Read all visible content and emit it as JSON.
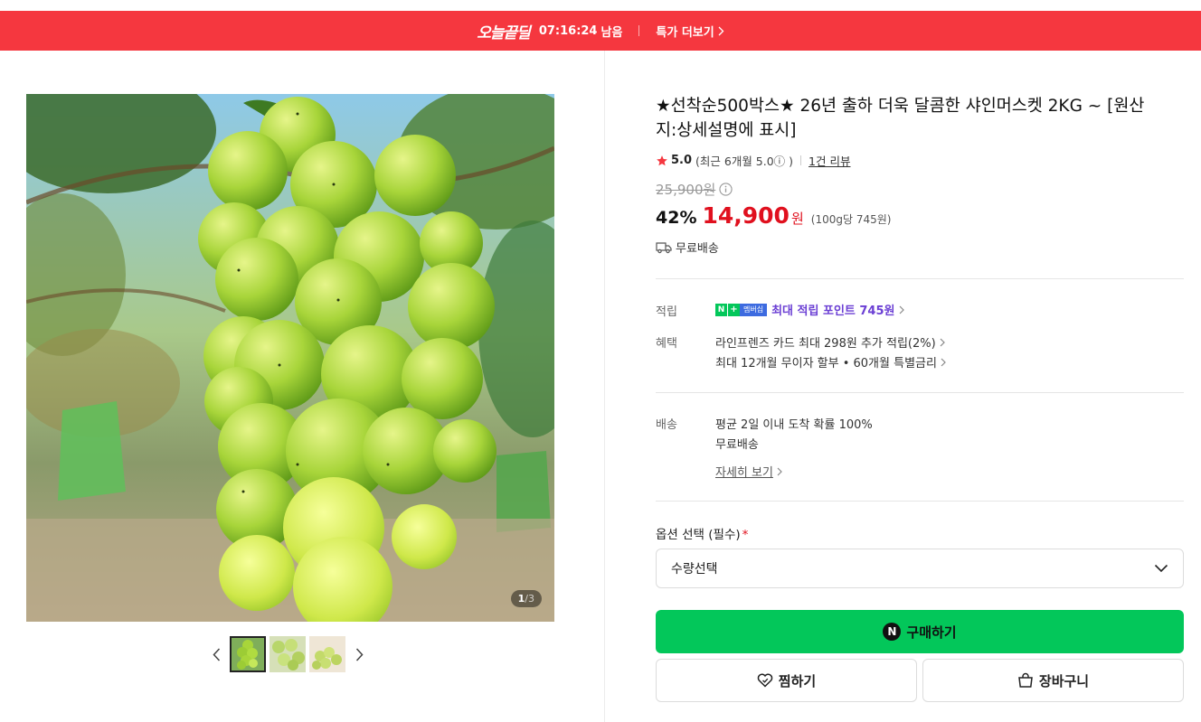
{
  "banner": {
    "logo": "오늘끝딜",
    "time": "07:16:24",
    "time_suffix": "남음",
    "link": "특가 더보기",
    "color": "#f5373f"
  },
  "gallery": {
    "counter_current": "1",
    "counter_total": "/3",
    "thumbs": [
      "thumb-1",
      "thumb-2",
      "thumb-3"
    ],
    "prev_icon": "chevron-left-icon",
    "next_icon": "chevron-right-icon"
  },
  "product": {
    "title": "★선착순500박스★ 26년 출하 더욱 달콤한 샤인머스켓 2KG ~ [원산지:상세설명에 표시]",
    "rating_score": "5.0",
    "rating_recent": "(최근 6개월 5.0ⓘ )",
    "review_link": "1건 리뷰",
    "original_price": "25,900원",
    "discount": "42%",
    "price": "14,900",
    "currency": "원",
    "unit_price": "(100g당 745원)",
    "shipping_badge": "무료배송"
  },
  "details": {
    "points_label": "적립",
    "points_badge_n": "N",
    "points_badge_plus": "+",
    "points_badge_member": "멤버십",
    "points_text": "최대 적립 포인트 745원",
    "benefit_label": "혜택",
    "benefit_line1": "라인프렌즈 카드 최대 298원 추가 적립(2%)",
    "benefit_line2": "최대 12개월 무이자 할부 • 60개월 특별금리",
    "shipping_label": "배송",
    "shipping_line1": "평균 2일 이내 도착 확률 100%",
    "shipping_line2": "무료배송",
    "shipping_more": "자세히 보기"
  },
  "options": {
    "label": "옵션 선택 (필수)",
    "required_mark": "*",
    "select_value": "수량선택"
  },
  "actions": {
    "buy_logo": "N",
    "buy_label": "구매하기",
    "wish_label": "찜하기",
    "cart_label": "장바구니",
    "buy_color": "#03c75a"
  }
}
